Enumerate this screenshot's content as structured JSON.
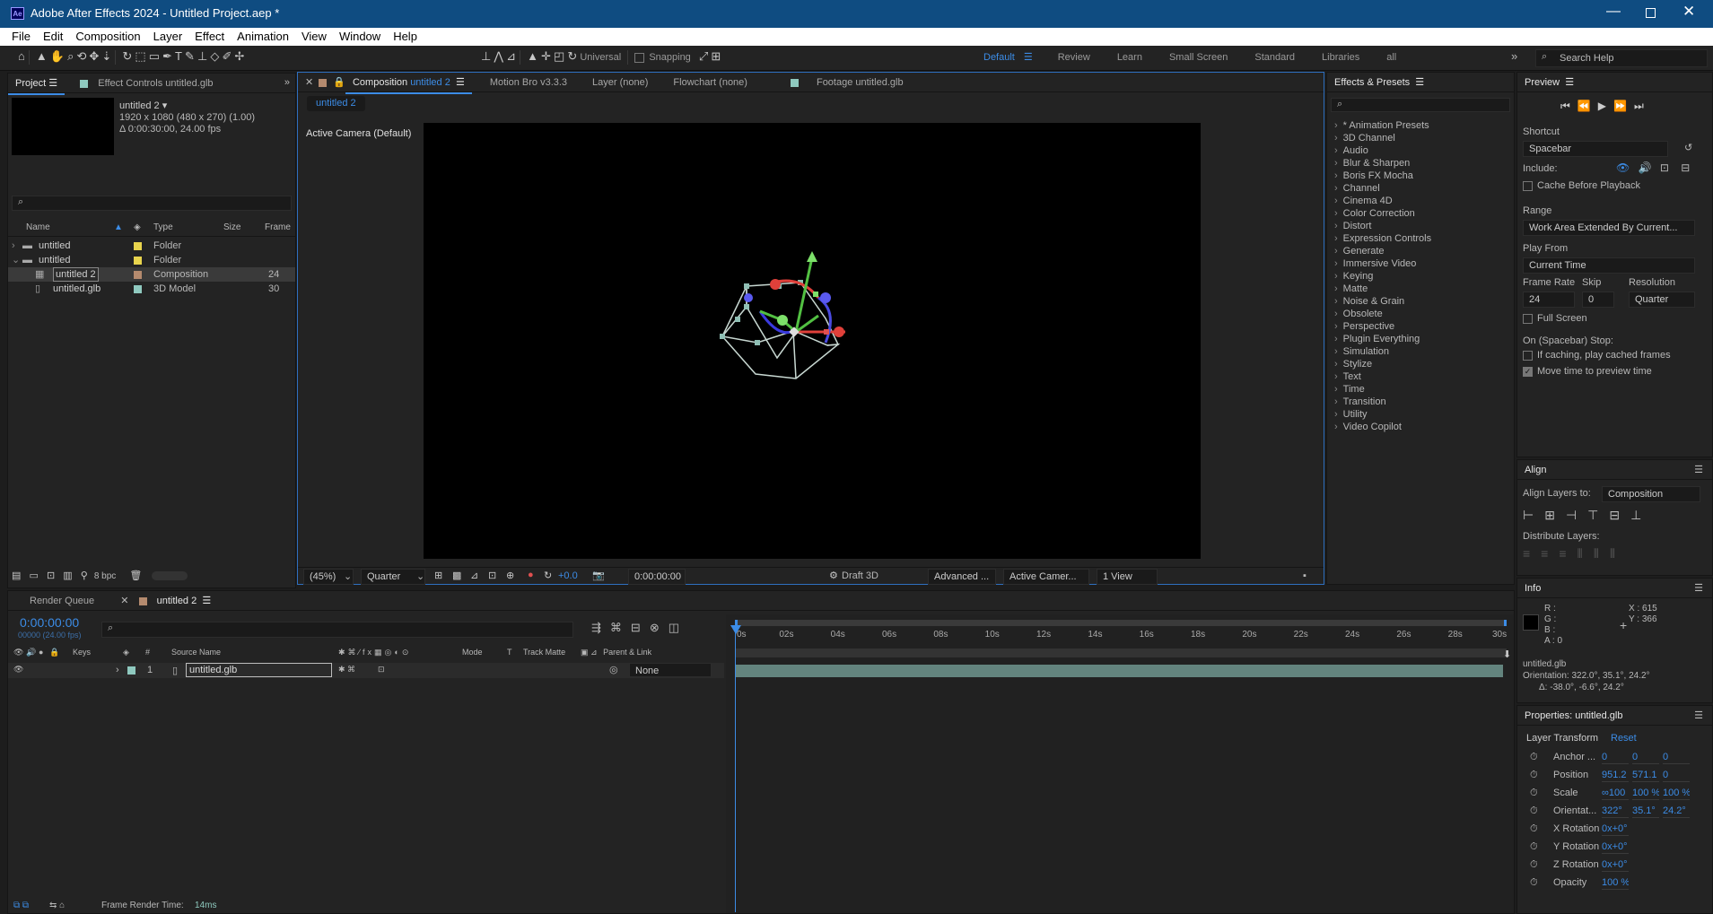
{
  "window": {
    "title": "Adobe After Effects 2024 - Untitled Project.aep *",
    "app_badge": "Ae"
  },
  "menu": [
    "File",
    "Edit",
    "Composition",
    "Layer",
    "Effect",
    "Animation",
    "View",
    "Window",
    "Help"
  ],
  "toolbar": {
    "universal": "Universal",
    "snapping": "Snapping",
    "workspaces": [
      "Default",
      "Review",
      "Learn",
      "Small Screen",
      "Standard",
      "Libraries",
      "all"
    ],
    "search_placeholder": "Search Help"
  },
  "project": {
    "tab_label": "Project",
    "effect_controls_label": "Effect Controls untitled.glb",
    "thumb_name": "untitled 2 ▾",
    "thumb_dims": "1920 x 1080  (480 x 270) (1.00)",
    "thumb_dur": "Δ 0:00:30:00, 24.00 fps",
    "columns": {
      "name": "Name",
      "type": "Type",
      "size": "Size",
      "frame": "Frame"
    },
    "items": [
      {
        "name": "untitled",
        "type": "Folder",
        "size": "",
        "frame": "",
        "color": "#e8d44d",
        "kind": "folder",
        "indent": 0,
        "open": false
      },
      {
        "name": "untitled",
        "type": "Folder",
        "size": "",
        "frame": "",
        "color": "#e8d44d",
        "kind": "folder",
        "indent": 0,
        "open": true
      },
      {
        "name": "untitled 2",
        "type": "Composition",
        "size": "",
        "frame": "24",
        "color": "#b48a6e",
        "kind": "comp",
        "indent": 1,
        "selected": true
      },
      {
        "name": "untitled.glb",
        "type": "3D Model",
        "size": "",
        "frame": "30",
        "color": "#8fc9bf",
        "kind": "file",
        "indent": 1
      }
    ],
    "bpc": "8 bpc"
  },
  "comp": {
    "tabs": [
      "Composition untitled 2",
      "Motion Bro v3.3.3",
      "Layer (none)",
      "Flowchart (none)",
      "Footage untitled.glb"
    ],
    "subtab": "untitled 2",
    "camera_label": "Active Camera (Default)",
    "footer": {
      "zoom": "(45%)",
      "resolution": "Quarter",
      "exposure": "+0.0",
      "timecode": "0:00:00:00",
      "draft": "Draft 3D",
      "renderer": "Advanced ...",
      "camera": "Active Camer...",
      "views": "1 View"
    }
  },
  "effects": {
    "title": "Effects & Presets",
    "items": [
      "* Animation Presets",
      "3D Channel",
      "Audio",
      "Blur & Sharpen",
      "Boris FX Mocha",
      "Channel",
      "Cinema 4D",
      "Color Correction",
      "Distort",
      "Expression Controls",
      "Generate",
      "Immersive Video",
      "Keying",
      "Matte",
      "Noise & Grain",
      "Obsolete",
      "Perspective",
      "Plugin Everything",
      "Simulation",
      "Stylize",
      "Text",
      "Time",
      "Transition",
      "Utility",
      "Video Copilot"
    ]
  },
  "preview": {
    "title": "Preview",
    "shortcut_label": "Shortcut",
    "shortcut": "Spacebar",
    "include_label": "Include:",
    "cache_before": "Cache Before Playback",
    "range_label": "Range",
    "range": "Work Area Extended By Current...",
    "play_from_label": "Play From",
    "play_from": "Current Time",
    "frame_rate_label": "Frame Rate",
    "frame_rate": "24",
    "skip_label": "Skip",
    "skip": "0",
    "resolution_label": "Resolution",
    "resolution": "Quarter",
    "full_screen": "Full Screen",
    "on_stop": "On (Spacebar) Stop:",
    "if_caching": "If caching, play cached frames",
    "move_time": "Move time to preview time"
  },
  "align": {
    "title": "Align",
    "align_to_label": "Align Layers to:",
    "align_to": "Composition",
    "distribute_label": "Distribute Layers:"
  },
  "info": {
    "title": "Info",
    "r": "R :",
    "g": "G :",
    "b": "B :",
    "a": "A : 0",
    "x": "X : 615",
    "y": "Y : 366",
    "layer": "untitled.glb",
    "orientation": "Orientation: 322.0°, 35.1°, 24.2°",
    "delta": "Δ: -38.0°, -6.6°, 24.2°"
  },
  "properties": {
    "title": "Properties: untitled.glb",
    "section": "Layer Transform",
    "reset": "Reset",
    "rows": [
      {
        "label": "Anchor ...",
        "values": [
          "0",
          "0",
          "0"
        ]
      },
      {
        "label": "Position",
        "values": [
          "951.2",
          "571.1",
          "0"
        ]
      },
      {
        "label": "Scale",
        "values": [
          "∞100 ",
          "100 %",
          "100 %"
        ]
      },
      {
        "label": "Orientat...",
        "values": [
          "322°",
          "35.1°",
          "24.2°"
        ]
      },
      {
        "label": "X Rotation",
        "values": [
          "0x+0°"
        ]
      },
      {
        "label": "Y Rotation",
        "values": [
          "0x+0°"
        ]
      },
      {
        "label": "Z Rotation",
        "values": [
          "0x+0°"
        ]
      },
      {
        "label": "Opacity",
        "values": [
          "100 %"
        ]
      }
    ]
  },
  "timeline": {
    "render_queue": "Render Queue",
    "comp_tab": "untitled 2",
    "timecode": "0:00:00:00",
    "frame_info": "00000 (24.00 fps)",
    "columns": {
      "keys": "Keys",
      "num": "#",
      "source": "Source Name",
      "mode": "Mode",
      "t": "T",
      "track": "Track Matte",
      "parent": "Parent & Link"
    },
    "layer": {
      "num": "1",
      "name": "untitled.glb",
      "parent": "None"
    },
    "ruler": [
      "0s",
      "02s",
      "04s",
      "06s",
      "08s",
      "10s",
      "12s",
      "14s",
      "16s",
      "18s",
      "20s",
      "22s",
      "24s",
      "26s",
      "28s",
      "30s"
    ],
    "render_time_label": "Frame Render Time:",
    "render_time": "14ms"
  }
}
